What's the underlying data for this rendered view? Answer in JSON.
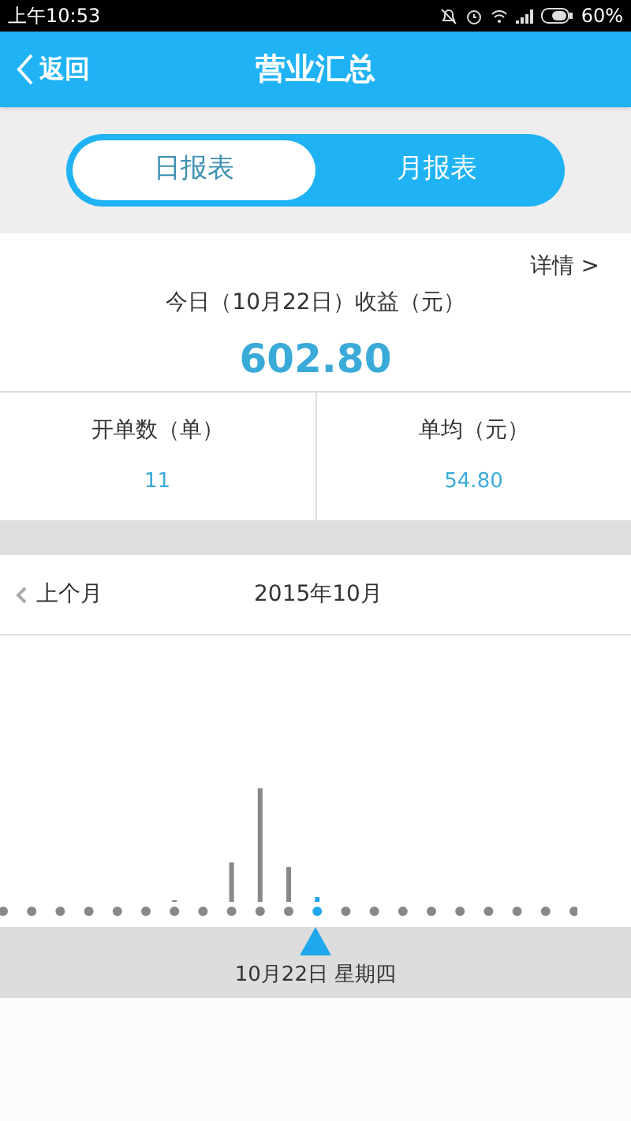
{
  "status_bar": {
    "time": "上午10:53",
    "battery": "60%"
  },
  "header": {
    "back": "返回",
    "title": "营业汇总"
  },
  "tabs": [
    {
      "label": "日报表",
      "selected": true
    },
    {
      "label": "月报表",
      "selected": false
    }
  ],
  "summary": {
    "details_link": "详情 >",
    "caption": "今日（10月22日）收益（元）",
    "amount": "602.80"
  },
  "stats": [
    {
      "label": "开单数（单）",
      "value": "11"
    },
    {
      "label": "单均（元）",
      "value": "54.80"
    }
  ],
  "month_nav": {
    "previous": "上个月",
    "month": "2015年10月"
  },
  "selected_date": "10月22日 星期四"
}
